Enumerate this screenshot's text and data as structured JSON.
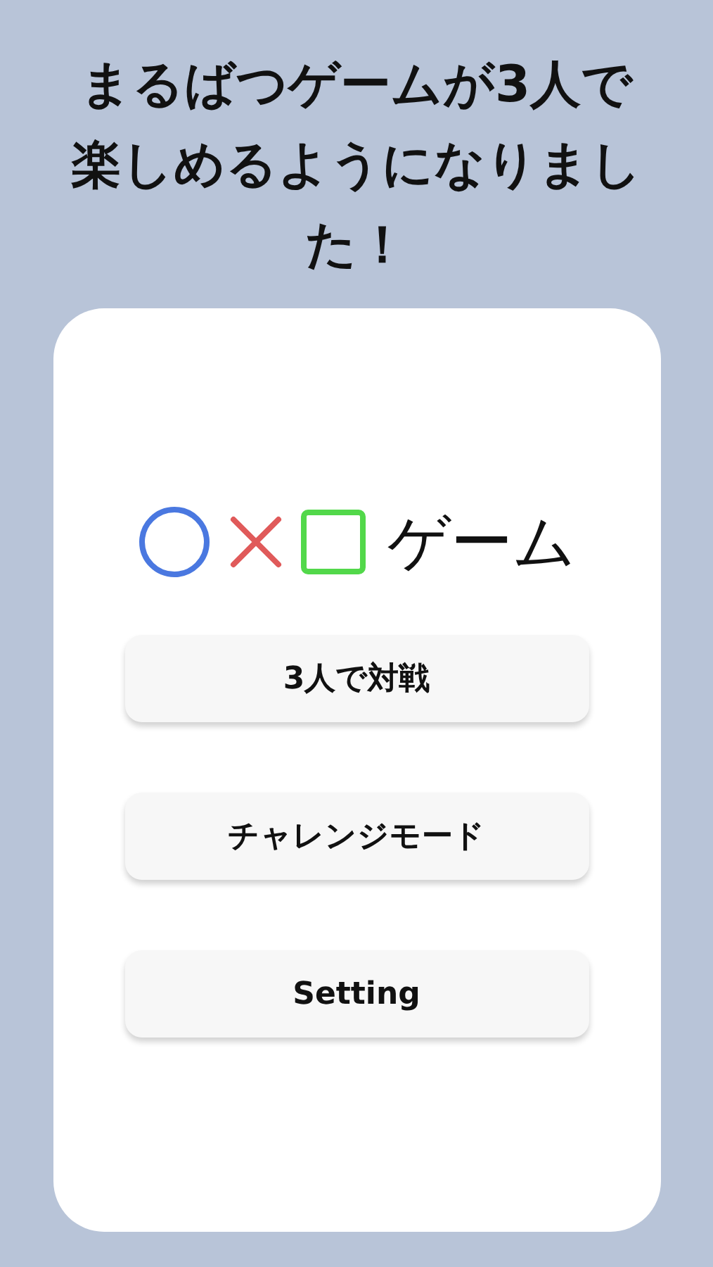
{
  "headline": "まるばつゲームが3人で楽しめるようになりました！",
  "logo": {
    "title": "ゲーム"
  },
  "buttons": [
    "3人で対戦",
    "チャレンジモード",
    "Setting"
  ]
}
